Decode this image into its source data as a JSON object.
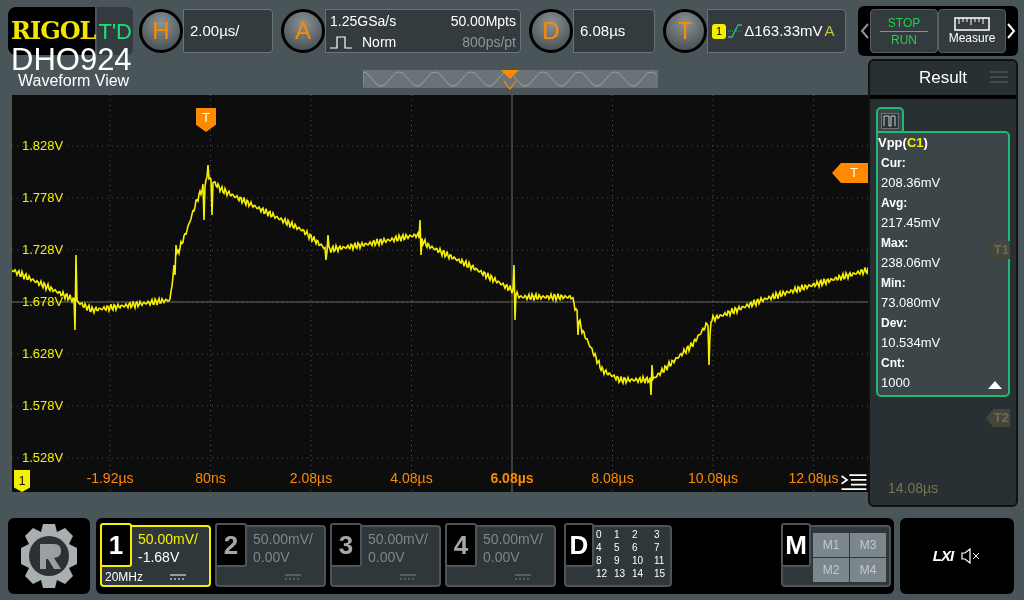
{
  "brand": {
    "logo": "RIGOL",
    "model": "DHO924"
  },
  "top_bar": {
    "td": "T'D",
    "horizontal": {
      "key": "H",
      "timebase": "2.00µs/"
    },
    "acquire": {
      "key": "A",
      "sample_rate": "1.25GSa/s",
      "mode": "Norm",
      "memory": "50.00Mpts",
      "resolution": "800ps/pt"
    },
    "delay": {
      "key": "D",
      "value": "6.08µs"
    },
    "trigger": {
      "key": "T",
      "source": "1",
      "level": "Δ163.33mV",
      "coupling": "A"
    }
  },
  "run_button": {
    "top": "STOP",
    "bottom": "RUN"
  },
  "measure_button": {
    "label": "Measure"
  },
  "waveform_view": {
    "title": "Waveform View",
    "trigger_position_marker": "T",
    "trigger_level_marker": "T",
    "channel_marker": "1",
    "y_labels": [
      "1.828V",
      "1.778V",
      "1.728V",
      "1.678V",
      "1.628V",
      "1.578V",
      "1.528V"
    ],
    "x_labels": [
      "-1.92µs",
      "80ns",
      "2.08µs",
      "4.08µs",
      "6.08µs",
      "8.08µs",
      "10.08µs",
      "12.08µs"
    ]
  },
  "result_panel": {
    "title": "Result",
    "hidden_time_label": "14.08µs",
    "cursor_markers": [
      "T1",
      "T2"
    ],
    "measurement": {
      "prefix": "Vpp(",
      "source": "C1",
      "suffix": ")",
      "stats": [
        {
          "label": "Cur:",
          "value": "208.36mV"
        },
        {
          "label": "Avg:",
          "value": "217.45mV"
        },
        {
          "label": "Max:",
          "value": "238.06mV"
        },
        {
          "label": "Min:",
          "value": "73.080mV"
        },
        {
          "label": "Dev:",
          "value": "10.534mV"
        },
        {
          "label": "Cnt:",
          "value": "1000"
        }
      ]
    }
  },
  "channels": [
    {
      "number": "1",
      "scale": "50.00mV/",
      "offset": "-1.68V",
      "bandwidth": "20MHz",
      "active": true
    },
    {
      "number": "2",
      "scale": "50.00mV/",
      "offset": "0.00V",
      "active": false
    },
    {
      "number": "3",
      "scale": "50.00mV/",
      "offset": "0.00V",
      "active": false
    },
    {
      "number": "4",
      "scale": "50.00mV/",
      "offset": "0.00V",
      "active": false
    }
  ],
  "digital": {
    "key": "D",
    "bits": [
      "0",
      "1",
      "2",
      "3",
      "4",
      "5",
      "6",
      "7",
      "8",
      "9",
      "10",
      "11",
      "12",
      "13",
      "14",
      "15"
    ]
  },
  "math": {
    "key": "M",
    "items": [
      "M1",
      "M3",
      "M2",
      "M4"
    ]
  },
  "status": {
    "lxi": "LXI"
  }
}
